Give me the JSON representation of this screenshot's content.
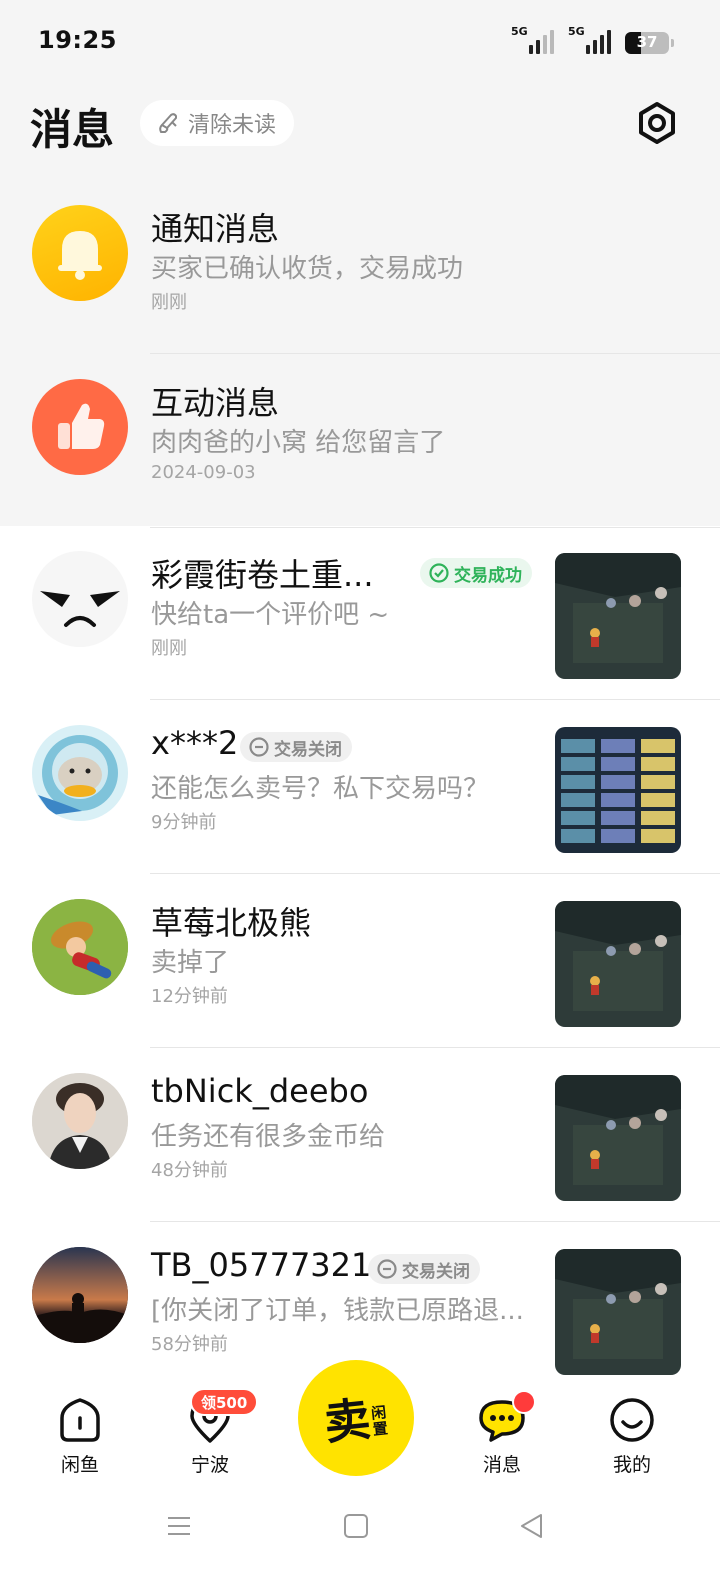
{
  "status_bar": {
    "time": "19:25",
    "network_1": "5G",
    "network_2": "5G",
    "battery": "37"
  },
  "header": {
    "title": "消息",
    "clear_unread": "清除未读"
  },
  "system_rows": [
    {
      "title": "通知消息",
      "preview": "买家已确认收货，交易成功",
      "time": "刚刚",
      "icon": "bell-icon",
      "color": "#ffc300"
    },
    {
      "title": "互动消息",
      "preview": "肉肉爸的小窝 给您留言了",
      "time": "2024-09-03",
      "icon": "thumbs-up-icon",
      "color": "#ff6a45"
    }
  ],
  "conversations": [
    {
      "name": "彩霞街卷土重...",
      "badge": "交易成功",
      "badge_type": "success",
      "preview": "快给ta一个评价吧 ~",
      "time": "刚刚"
    },
    {
      "name": "x***2",
      "badge": "交易关闭",
      "badge_type": "closed",
      "preview": "还能怎么卖号？私下交易吗？",
      "time": "9分钟前"
    },
    {
      "name": "草莓北极熊",
      "badge": "",
      "badge_type": "",
      "preview": "卖掉了",
      "time": "12分钟前"
    },
    {
      "name": "tbNick_deebo",
      "badge": "",
      "badge_type": "",
      "preview": "任务还有很多金币给",
      "time": "48分钟前"
    },
    {
      "name": "TB_05777321",
      "badge": "交易关闭",
      "badge_type": "closed",
      "preview": "[你关闭了订单，钱款已原路退...",
      "time": "58分钟前"
    }
  ],
  "tabbar": {
    "home": "闲鱼",
    "local": "宁波",
    "local_badge": "领500",
    "sell_main": "卖",
    "sell_sub_1": "闲",
    "sell_sub_2": "置",
    "messages": "消息",
    "mine": "我的"
  },
  "colors": {
    "accent": "#ffe300",
    "success": "#2fb35a",
    "alert": "#ff3b3b"
  }
}
